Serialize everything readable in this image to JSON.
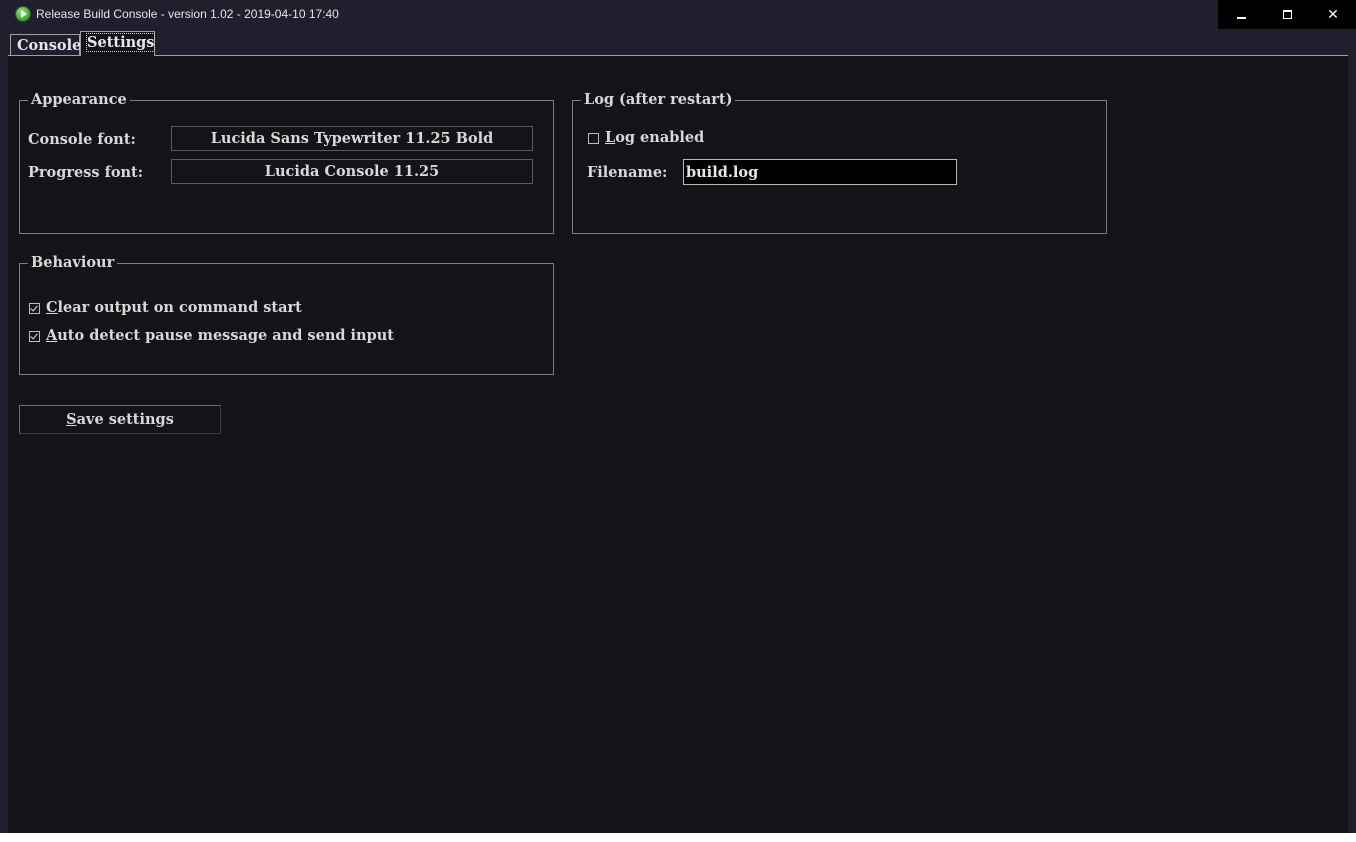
{
  "window": {
    "title": "Release Build Console - version 1.02 - 2019-04-10 17:40",
    "controls": {
      "minimize": "",
      "maximize": "",
      "close": "✕"
    }
  },
  "tabs": [
    {
      "label": "Console",
      "active": false
    },
    {
      "label": "Settings",
      "active": true
    }
  ],
  "appearance": {
    "legend": "Appearance",
    "console_font_label": "Console font:",
    "console_font_value": "Lucida Sans Typewriter 11.25 Bold",
    "progress_font_label": "Progress font:",
    "progress_font_value": "Lucida Console 11.25"
  },
  "log": {
    "legend": "Log (after restart)",
    "enabled_label_accel": "L",
    "enabled_label_rest": "og enabled",
    "enabled": false,
    "filename_label": "Filename:",
    "filename_value": "build.log"
  },
  "behaviour": {
    "legend": "Behaviour",
    "clear_output_accel": "C",
    "clear_output_rest": "lear output on command start",
    "clear_output_checked": true,
    "auto_detect_accel": "A",
    "auto_detect_rest": "uto detect pause message and send input",
    "auto_detect_checked": true
  },
  "save_button": {
    "accel": "S",
    "rest": "ave settings"
  },
  "colors": {
    "titlebar_bg": "#1f1f2e",
    "pane_bg": "#131318",
    "text": "#d8d8d8",
    "app_icon": "#2f9b2a"
  }
}
